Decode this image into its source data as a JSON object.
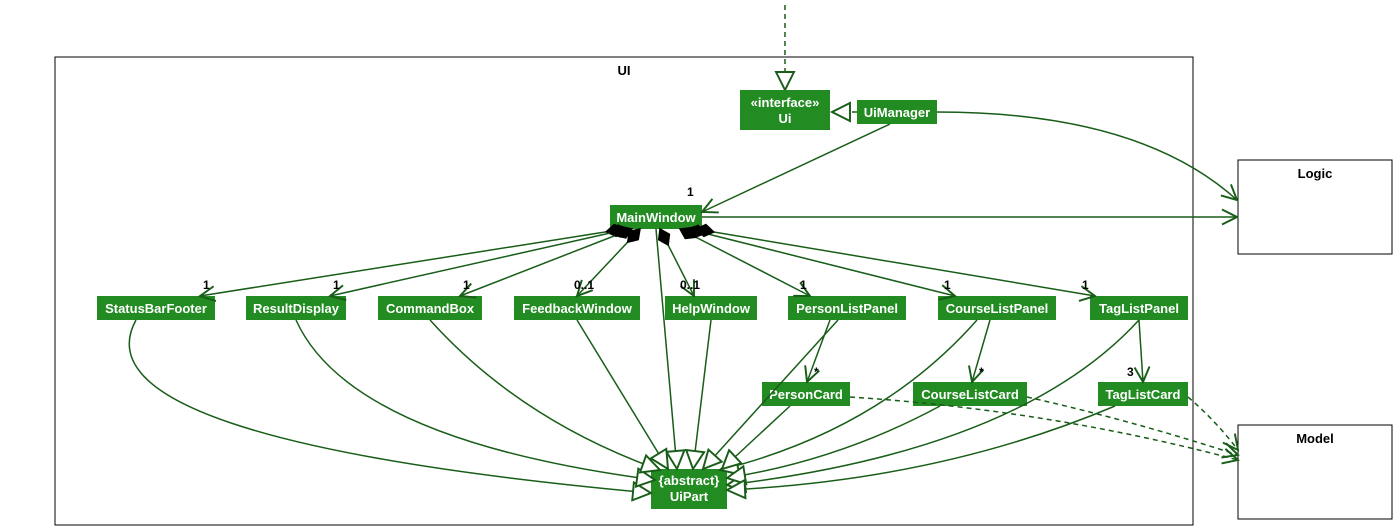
{
  "packages": {
    "ui": {
      "label": "UI"
    },
    "logic": {
      "label": "Logic"
    },
    "model": {
      "label": "Model"
    }
  },
  "nodes": {
    "ui_interface": {
      "line1": "«interface»",
      "line2": "Ui"
    },
    "uimanager": {
      "label": "UiManager"
    },
    "mainwindow": {
      "label": "MainWindow"
    },
    "statusbar": {
      "label": "StatusBarFooter"
    },
    "resultdisplay": {
      "label": "ResultDisplay"
    },
    "commandbox": {
      "label": "CommandBox"
    },
    "feedbackwindow": {
      "label": "FeedbackWindow"
    },
    "helpwindow": {
      "label": "HelpWindow"
    },
    "personlistpanel": {
      "label": "PersonListPanel"
    },
    "courselistpanel": {
      "label": "CourseListPanel"
    },
    "taglistpanel": {
      "label": "TagListPanel"
    },
    "personcard": {
      "label": "PersonCard"
    },
    "courselistcard": {
      "label": "CourseListCard"
    },
    "taglistcard": {
      "label": "TagListCard"
    },
    "uipart": {
      "line1": "{abstract}",
      "line2": "UiPart"
    }
  },
  "multiplicities": {
    "um_to_mw": "1",
    "mw_statusbar": "1",
    "mw_resultdisplay": "1",
    "mw_commandbox": "1",
    "mw_feedback": "0..1",
    "mw_help": "0..1",
    "mw_personlist": "1",
    "mw_courselist": "1",
    "mw_taglist": "1",
    "pl_personcard": "*",
    "cl_coursecard": "*",
    "tl_tagcard": "3"
  },
  "chart_data": {
    "type": "uml-class-diagram",
    "packages": [
      "UI",
      "Logic",
      "Model"
    ],
    "classes": [
      {
        "name": "Ui",
        "stereotype": "interface",
        "package": "UI"
      },
      {
        "name": "UiManager",
        "package": "UI"
      },
      {
        "name": "MainWindow",
        "package": "UI"
      },
      {
        "name": "StatusBarFooter",
        "package": "UI"
      },
      {
        "name": "ResultDisplay",
        "package": "UI"
      },
      {
        "name": "CommandBox",
        "package": "UI"
      },
      {
        "name": "FeedbackWindow",
        "package": "UI"
      },
      {
        "name": "HelpWindow",
        "package": "UI"
      },
      {
        "name": "PersonListPanel",
        "package": "UI"
      },
      {
        "name": "CourseListPanel",
        "package": "UI"
      },
      {
        "name": "TagListPanel",
        "package": "UI"
      },
      {
        "name": "PersonCard",
        "package": "UI"
      },
      {
        "name": "CourseListCard",
        "package": "UI"
      },
      {
        "name": "TagListCard",
        "package": "UI"
      },
      {
        "name": "UiPart",
        "stereotype": "abstract",
        "package": "UI"
      }
    ],
    "relationships": [
      {
        "from": "UiManager",
        "to": "Ui",
        "type": "realization"
      },
      {
        "from": "UiManager",
        "to": "MainWindow",
        "type": "association",
        "mult": "1"
      },
      {
        "from": "UiManager",
        "to": "Logic",
        "type": "association"
      },
      {
        "from": "MainWindow",
        "to": "Logic",
        "type": "association"
      },
      {
        "from": "MainWindow",
        "to": "StatusBarFooter",
        "type": "composition",
        "mult": "1"
      },
      {
        "from": "MainWindow",
        "to": "ResultDisplay",
        "type": "composition",
        "mult": "1"
      },
      {
        "from": "MainWindow",
        "to": "CommandBox",
        "type": "composition",
        "mult": "1"
      },
      {
        "from": "MainWindow",
        "to": "FeedbackWindow",
        "type": "composition",
        "mult": "0..1"
      },
      {
        "from": "MainWindow",
        "to": "HelpWindow",
        "type": "composition",
        "mult": "0..1"
      },
      {
        "from": "MainWindow",
        "to": "PersonListPanel",
        "type": "composition",
        "mult": "1"
      },
      {
        "from": "MainWindow",
        "to": "CourseListPanel",
        "type": "composition",
        "mult": "1"
      },
      {
        "from": "MainWindow",
        "to": "TagListPanel",
        "type": "composition",
        "mult": "1"
      },
      {
        "from": "PersonListPanel",
        "to": "PersonCard",
        "type": "association",
        "mult": "*"
      },
      {
        "from": "CourseListPanel",
        "to": "CourseListCard",
        "type": "association",
        "mult": "*"
      },
      {
        "from": "TagListPanel",
        "to": "TagListCard",
        "type": "association",
        "mult": "3"
      },
      {
        "from": "MainWindow",
        "to": "UiPart",
        "type": "generalization"
      },
      {
        "from": "StatusBarFooter",
        "to": "UiPart",
        "type": "generalization"
      },
      {
        "from": "ResultDisplay",
        "to": "UiPart",
        "type": "generalization"
      },
      {
        "from": "CommandBox",
        "to": "UiPart",
        "type": "generalization"
      },
      {
        "from": "FeedbackWindow",
        "to": "UiPart",
        "type": "generalization"
      },
      {
        "from": "HelpWindow",
        "to": "UiPart",
        "type": "generalization"
      },
      {
        "from": "PersonListPanel",
        "to": "UiPart",
        "type": "generalization"
      },
      {
        "from": "CourseListPanel",
        "to": "UiPart",
        "type": "generalization"
      },
      {
        "from": "TagListPanel",
        "to": "UiPart",
        "type": "generalization"
      },
      {
        "from": "PersonCard",
        "to": "UiPart",
        "type": "generalization"
      },
      {
        "from": "CourseListCard",
        "to": "UiPart",
        "type": "generalization"
      },
      {
        "from": "TagListCard",
        "to": "UiPart",
        "type": "generalization"
      },
      {
        "from": "PersonCard",
        "to": "Model",
        "type": "dependency"
      },
      {
        "from": "CourseListCard",
        "to": "Model",
        "type": "dependency"
      },
      {
        "from": "TagListCard",
        "to": "Model",
        "type": "dependency"
      },
      {
        "from": "external",
        "to": "Ui",
        "type": "dependency"
      }
    ]
  }
}
